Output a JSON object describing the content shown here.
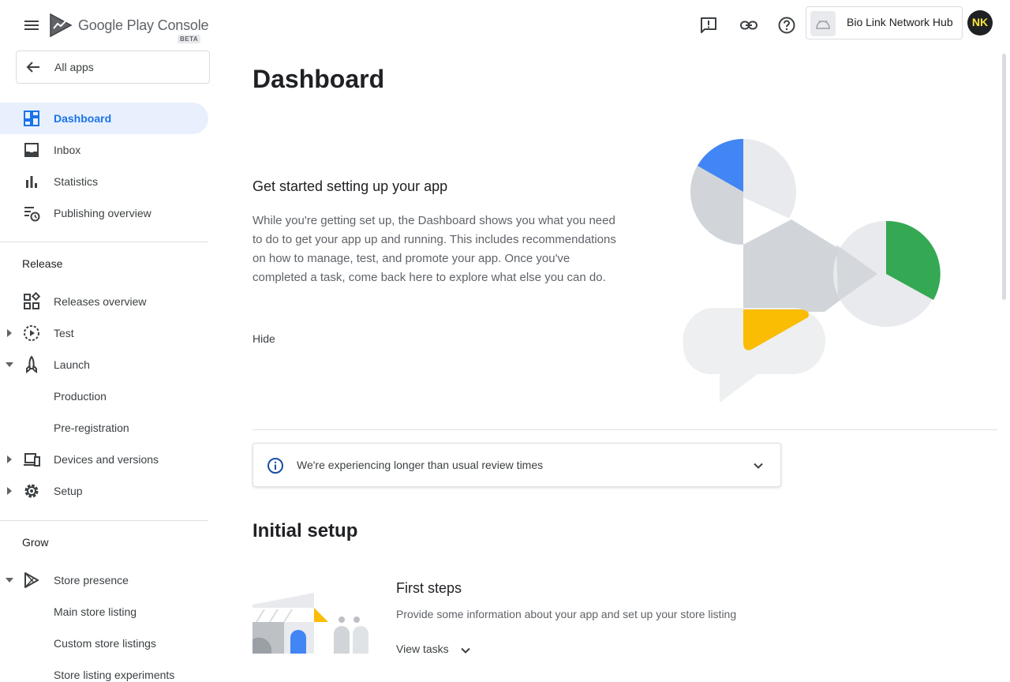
{
  "brand": {
    "name": "Google Play Console",
    "badge": "BETA"
  },
  "all_apps": {
    "label": "All apps"
  },
  "sidebar": {
    "main_items": [
      {
        "label": "Dashboard",
        "icon": "dashboard-icon",
        "active": true
      },
      {
        "label": "Inbox",
        "icon": "inbox-icon"
      },
      {
        "label": "Statistics",
        "icon": "bar-chart-icon"
      },
      {
        "label": "Publishing overview",
        "icon": "publishing-icon"
      }
    ],
    "release": {
      "title": "Release",
      "items": [
        {
          "label": "Releases overview",
          "icon": "releases-icon"
        },
        {
          "label": "Test",
          "icon": "test-icon",
          "caret": "collapsed"
        },
        {
          "label": "Launch",
          "icon": "rocket-icon",
          "caret": "expanded"
        },
        {
          "label": "Production",
          "sub": true
        },
        {
          "label": "Pre-registration",
          "sub": true
        },
        {
          "label": "Devices and versions",
          "icon": "devices-icon",
          "caret": "collapsed"
        },
        {
          "label": "Setup",
          "icon": "gear-icon",
          "caret": "collapsed"
        }
      ]
    },
    "grow": {
      "title": "Grow",
      "items": [
        {
          "label": "Store presence",
          "icon": "play-icon",
          "caret": "expanded"
        },
        {
          "label": "Main store listing",
          "sub": true
        },
        {
          "label": "Custom store listings",
          "sub": true
        },
        {
          "label": "Store listing experiments",
          "sub": true
        }
      ]
    }
  },
  "topbar": {
    "icons": [
      "feedback-icon",
      "link-icon",
      "help-icon"
    ],
    "app_name": "Bio Link Network Hub",
    "avatar_initials": "NK"
  },
  "main": {
    "title": "Dashboard",
    "intro": {
      "title": "Get started setting up your app",
      "body": "While you're getting set up, the Dashboard shows you what you need to do to get your app up and running. This includes recommendations on how to manage, test, and promote your app. Once you've completed a task, come back here to explore what else you can do.",
      "hide_label": "Hide"
    },
    "notice": {
      "text": "We're experiencing longer than usual review times"
    },
    "setup": {
      "title": "Initial setup",
      "first_steps": {
        "title": "First steps",
        "description": "Provide some information about your app and set up your store listing",
        "view_tasks_label": "View tasks"
      }
    }
  },
  "colors": {
    "accent": "#1a73e8",
    "active_bg": "#e8f0fe",
    "illustration_blue": "#4285f4",
    "illustration_green": "#34a853",
    "illustration_yellow": "#fbbc04"
  }
}
